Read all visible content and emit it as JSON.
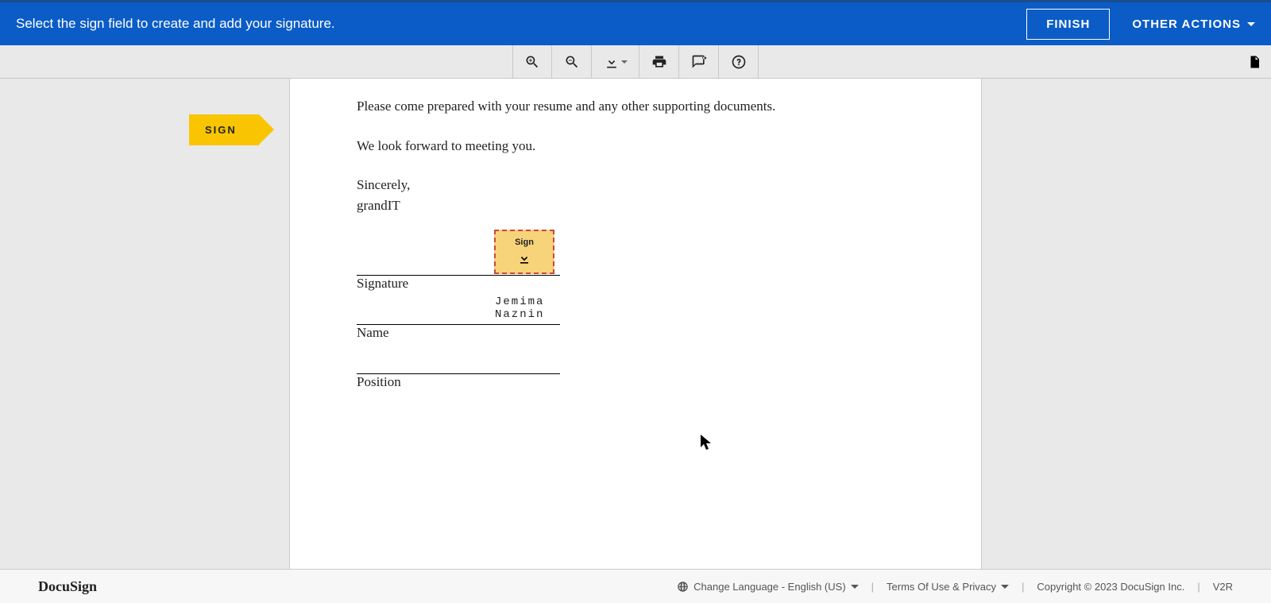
{
  "banner": {
    "message": "Select the sign field to create and add your signature.",
    "finish_label": "FINISH",
    "other_actions_label": "OTHER ACTIONS"
  },
  "toolbar": {
    "zoom_in": "zoom-in",
    "zoom_out": "zoom-out",
    "download": "download",
    "print": "print",
    "comment": "comment",
    "help": "help",
    "thumbnails": "thumbnails"
  },
  "sign_tag": {
    "label": "SIGN"
  },
  "document": {
    "line1": "Please come prepared with your resume and any other supporting documents.",
    "line2": "We look forward to meeting you.",
    "closing": "Sincerely,",
    "company": "grandIT",
    "sign_here_label": "Sign",
    "signature_label": "Signature",
    "name_label": "Name",
    "name_value": "Jemima Naznin",
    "position_label": "Position"
  },
  "footer": {
    "brand": "DocuSign",
    "lang_label": "Change Language - English (US)",
    "terms_label": "Terms Of Use & Privacy",
    "copyright": "Copyright © 2023 DocuSign Inc.",
    "version": "V2R"
  }
}
